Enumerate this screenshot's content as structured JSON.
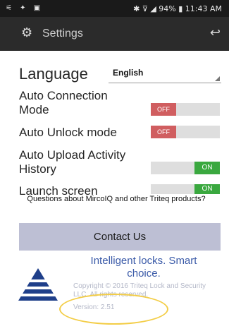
{
  "status_bar": {
    "left_icons": "⚟ ✦ ▣",
    "right_text": "✱ ⊽ ◢ 94% ▮ 11:43 AM"
  },
  "app_bar": {
    "title": "Settings",
    "icons": {
      "settings": "gear-icon",
      "back": "back-arrow-icon"
    }
  },
  "settings": {
    "language_label": "Language",
    "language_value": "English",
    "auto_connection_label": "Auto Connection Mode",
    "auto_connection_state": "OFF",
    "auto_unlock_label": "Auto Unlock mode",
    "auto_unlock_state": "OFF",
    "auto_upload_label": "Auto Upload Activity History",
    "auto_upload_state": "ON",
    "launch_screen_label": "Launch screen",
    "launch_screen_state": "ON"
  },
  "question_text": "Questions about MircoIQ and other Triteq products?",
  "contact_button": "Contact Us",
  "footer": {
    "tagline": "Intelligent locks. Smart choice.",
    "copyright": "Copyright © 2016 Triteq Lock and Security LLC. All rights reserved.",
    "version": "Version: 2.51"
  },
  "colors": {
    "off_toggle": "#d05e60",
    "on_toggle": "#3aa83f",
    "contact_button_bg": "#bdbfd4",
    "tagline": "#3a5aa8",
    "highlight_ring": "#f3cd47",
    "app_bar": "#2b2b2b"
  }
}
